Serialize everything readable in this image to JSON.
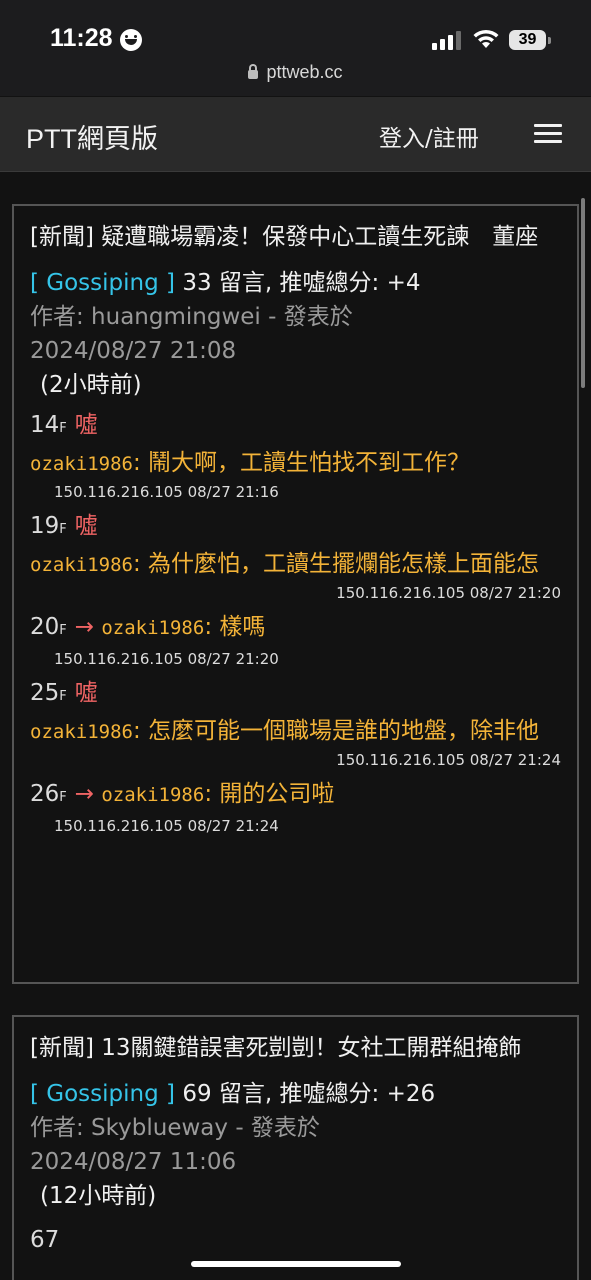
{
  "status": {
    "time": "11:28",
    "battery": "39",
    "url": "pttweb.cc"
  },
  "navbar": {
    "title": "PTT網頁版",
    "login": "登入/註冊"
  },
  "posts": [
    {
      "title": "[新聞] 疑遭職場霸凌！保發中心工讀生死諫　董座",
      "board": "[ Gossiping ]",
      "stats": "33 留言, 推噓總分: +4",
      "author_line": "作者: huangmingwei - 發表於",
      "datetime": "2024/08/27 21:08",
      "ago": "(2小時前)",
      "comments": [
        {
          "floor": "14",
          "suffix": "F",
          "tag": "噓",
          "user": "ozaki1986",
          "text": ": 鬧大啊，工讀生怕找不到工作？",
          "ip": "150.116.216.105 08/27 21:16"
        },
        {
          "floor": "19",
          "suffix": "F",
          "tag": "噓",
          "user": "ozaki1986",
          "text": ": 為什麼怕，工讀生擺爛能怎樣上面能怎",
          "ip": "150.116.216.105 08/27 21:20"
        },
        {
          "floor": "20",
          "suffix": "F",
          "tag": "→",
          "user": "ozaki1986",
          "text": ": 樣嗎",
          "ip": "150.116.216.105 08/27 21:20"
        },
        {
          "floor": "25",
          "suffix": "F",
          "tag": "噓",
          "user": "ozaki1986",
          "text": ": 怎麼可能一個職場是誰的地盤，除非他",
          "ip": "150.116.216.105 08/27 21:24"
        },
        {
          "floor": "26",
          "suffix": "F",
          "tag": "→",
          "user": "ozaki1986",
          "text": ": 開的公司啦",
          "ip": "150.116.216.105 08/27 21:24"
        }
      ]
    },
    {
      "title": "[新聞] 13關鍵錯誤害死剴剴！女社工開群組掩飾",
      "board": "[ Gossiping ]",
      "stats": "69 留言, 推噓總分: +26",
      "author_line": "作者: Skyblueway - 發表於",
      "datetime": "2024/08/27 11:06",
      "ago": "(12小時前)",
      "partial_floor": "67"
    }
  ],
  "colors": {
    "board": "#35c4e8",
    "comment": "#f3b338",
    "boo": "#f06464",
    "background": "#121212"
  }
}
